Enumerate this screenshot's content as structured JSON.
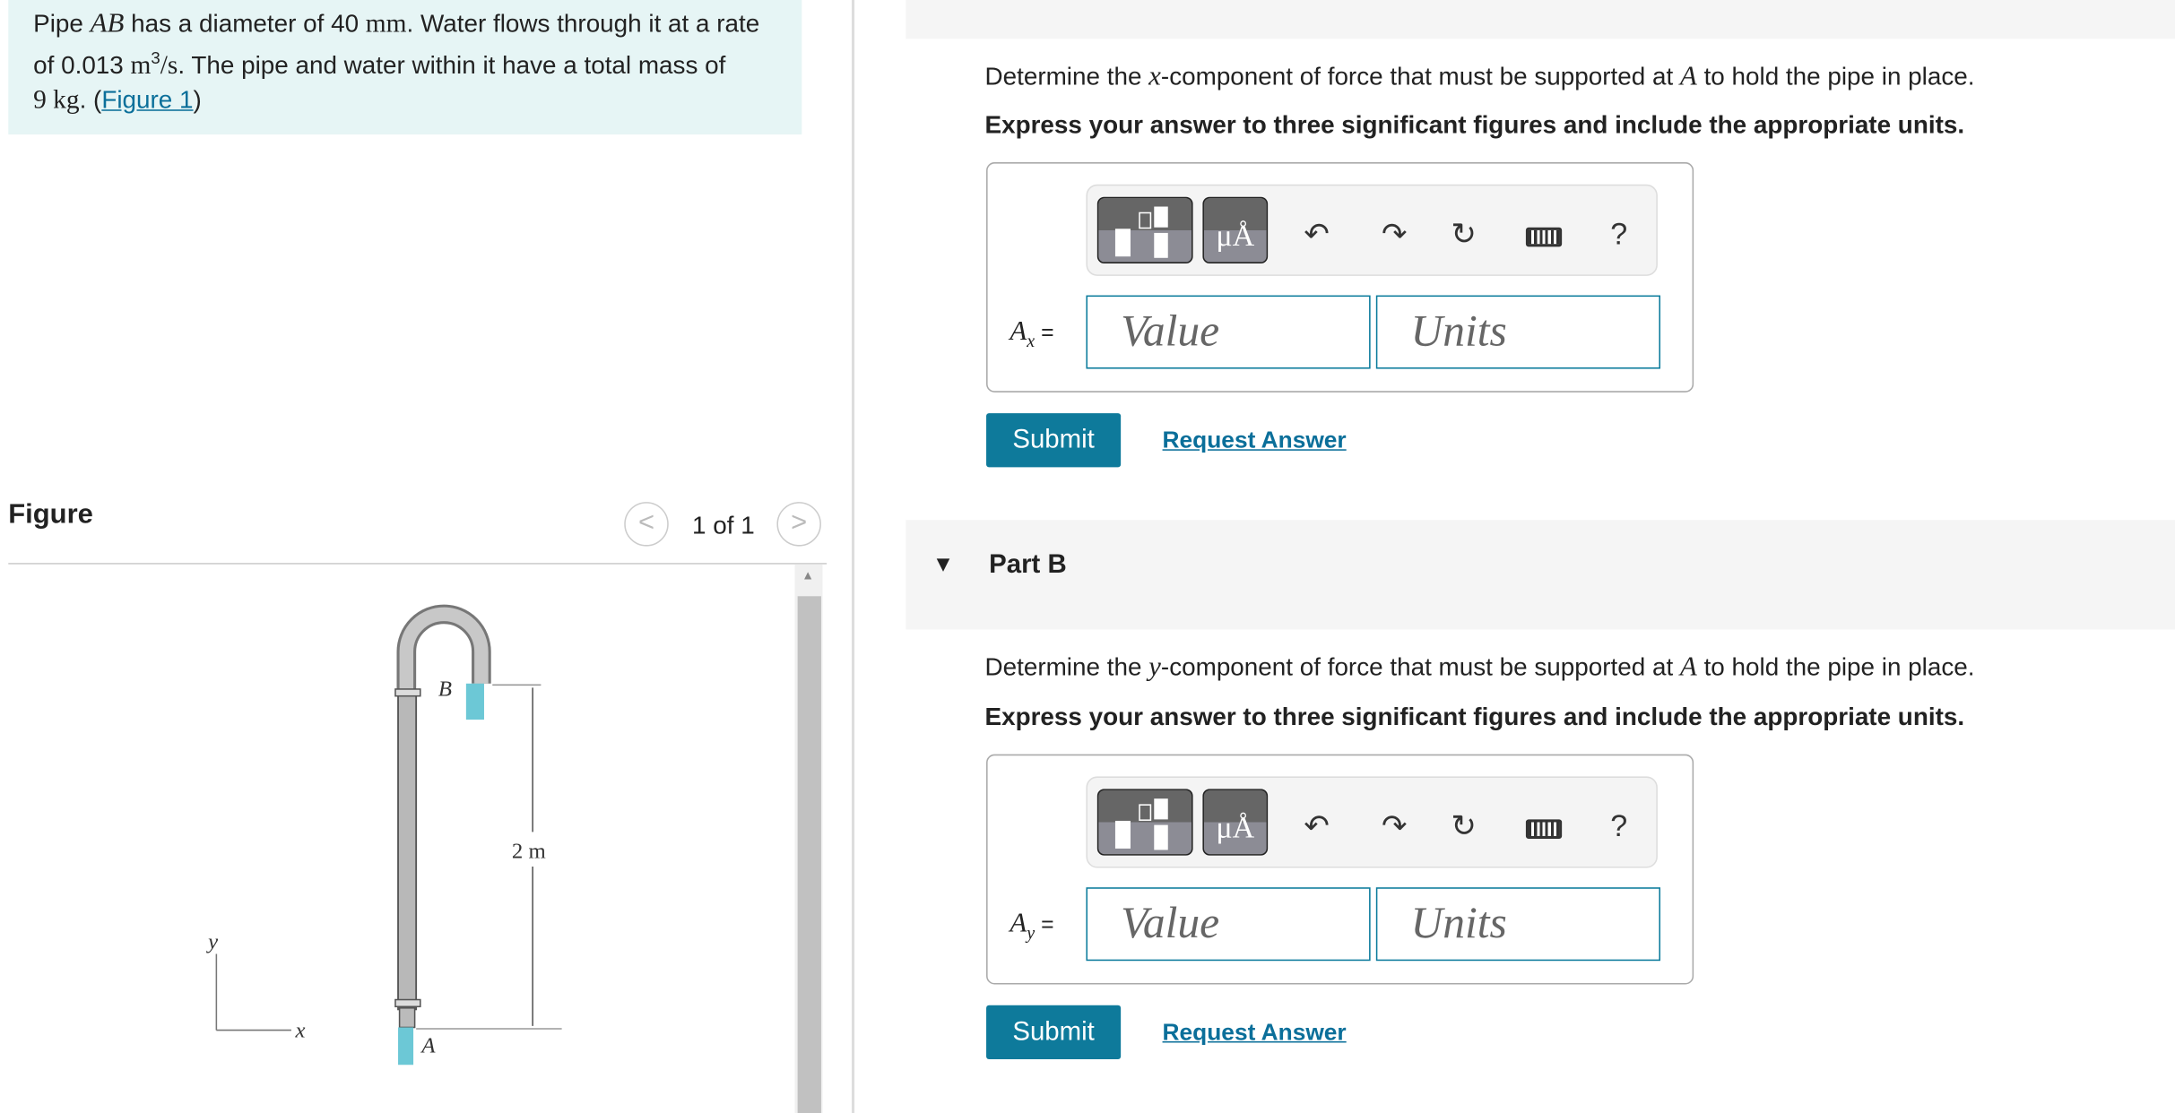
{
  "problem": {
    "t1": "Pipe ",
    "ab": "AB",
    "t2": " has a diameter of 40 ",
    "mm": "mm",
    "t3": ". Water flows through it at a rate",
    "t4": "of 0.013 ",
    "m3": "m",
    "exp": "3",
    "s": "/s",
    "t5": ". The pipe and water within it have a total mass of",
    "kg_num": "9 ",
    "kg": "kg",
    "t6": ". (",
    "fig_link": "Figure 1",
    "t7": ")"
  },
  "figure": {
    "title": "Figure",
    "pager": "1 of 1",
    "prev": "<",
    "next": ">",
    "labels": {
      "B": "B",
      "A": "A",
      "dim": "2 m",
      "y": "y",
      "x": "x"
    },
    "water_color": "#6cc8d6"
  },
  "partA": {
    "question_pre": "Determine the ",
    "var": "x",
    "question_post": "-component of force that must be supported at ",
    "pt": "A",
    "question_end": " to hold the pipe in place.",
    "instructions": "Express your answer to three significant figures and include the appropriate units.",
    "label": "A",
    "sub": "x",
    "eq": " =",
    "value_placeholder": "Value",
    "units_placeholder": "Units",
    "submit": "Submit",
    "request": "Request Answer"
  },
  "partB": {
    "header": "Part B",
    "question_pre": "Determine the ",
    "var": "y",
    "question_post": "-component of force that must be supported at ",
    "pt": "A",
    "question_end": " to hold the pipe in place.",
    "instructions": "Express your answer to three significant figures and include the appropriate units.",
    "label": "A",
    "sub": "y",
    "eq": " =",
    "value_placeholder": "Value",
    "units_placeholder": "Units",
    "submit": "Submit",
    "request": "Request Answer"
  },
  "toolbar": {
    "units_btn": "μÅ",
    "help": "?",
    "icons": [
      "templates-icon",
      "units-icon",
      "undo-icon",
      "redo-icon",
      "reset-icon",
      "keyboard-icon",
      "help-icon"
    ]
  },
  "colors": {
    "accent": "#0e7a9b",
    "problem_bg": "#e6f5f5"
  }
}
